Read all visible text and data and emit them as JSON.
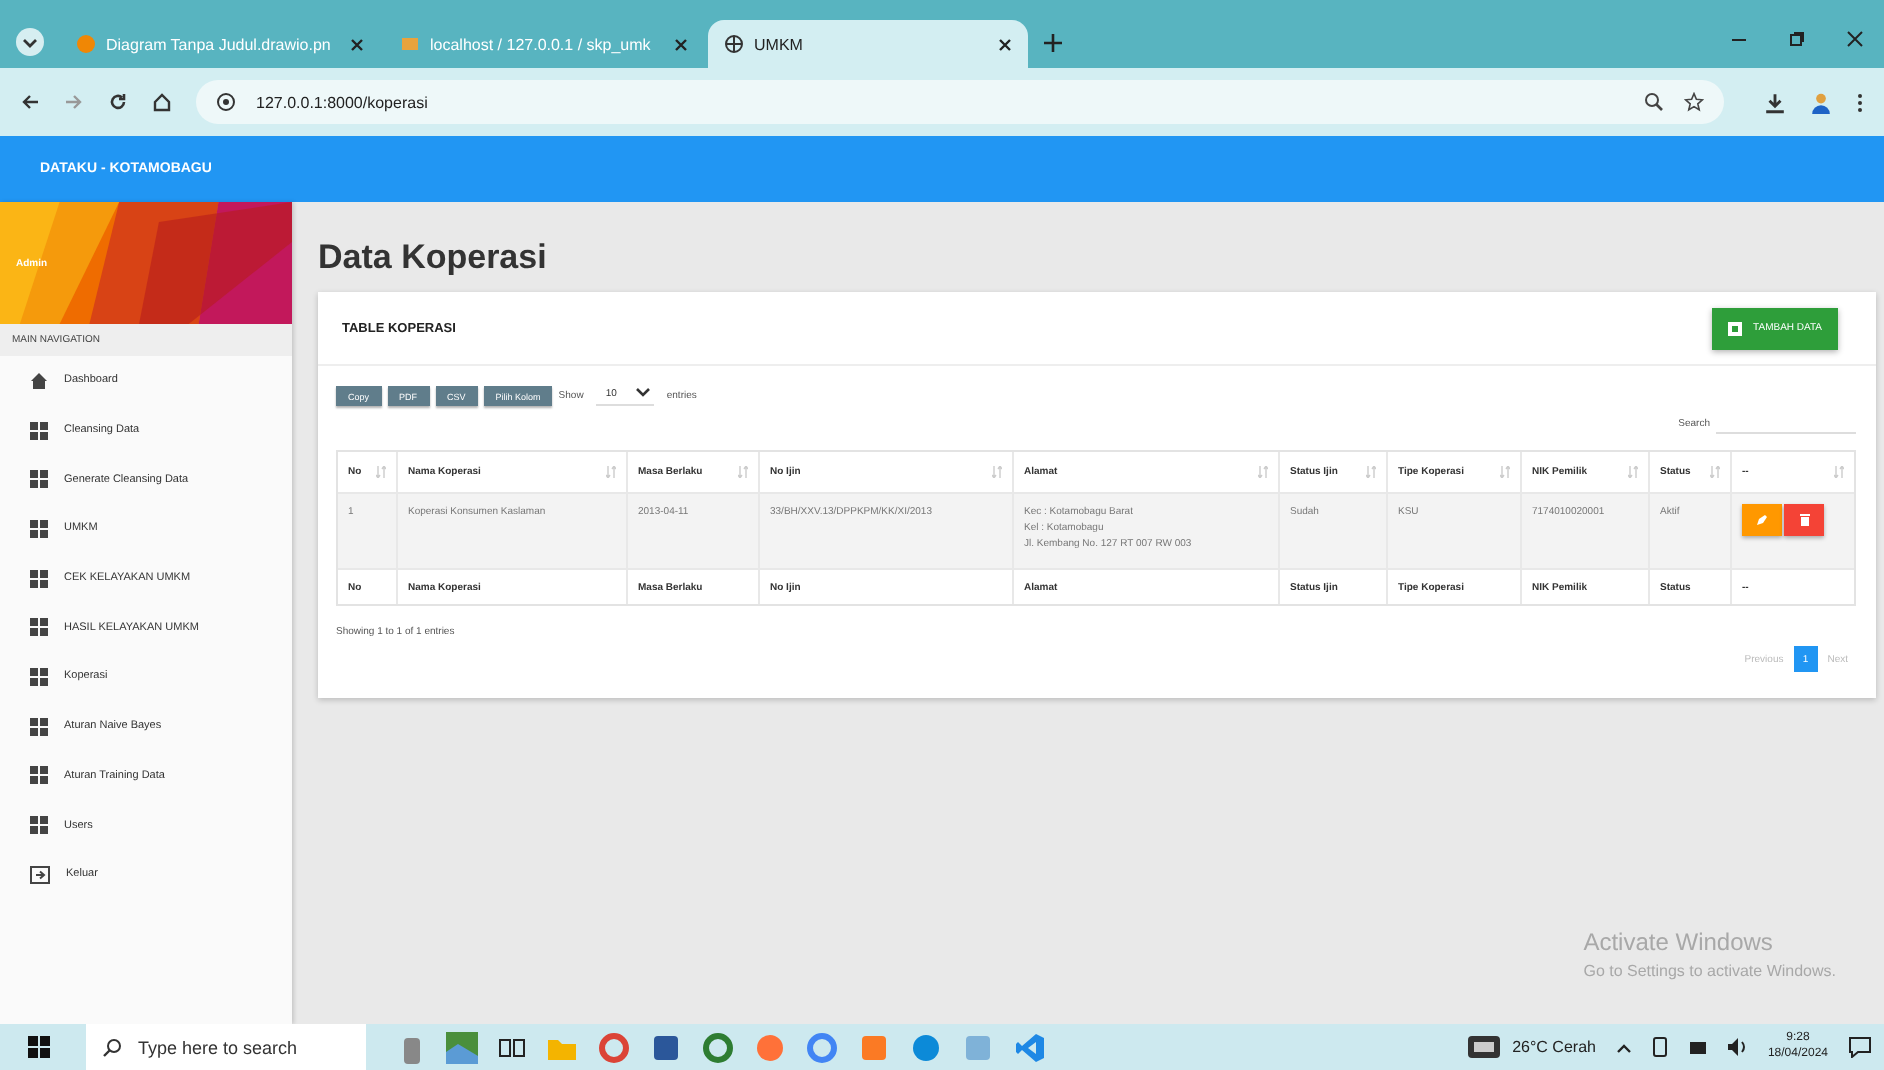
{
  "browser": {
    "tabs": [
      {
        "title": "Diagram Tanpa Judul.drawio.pn",
        "kind": "drawio",
        "selected": false
      },
      {
        "title": "localhost / 127.0.0.1 / skp_umk",
        "kind": "db",
        "selected": false
      },
      {
        "title": "UMKM",
        "kind": "globe",
        "selected": true
      }
    ],
    "url": "127.0.0.1:8000/koperasi"
  },
  "brand": "DATAKU - KOTAMOBAGU",
  "sidebar": {
    "user": "Admin",
    "section": "MAIN NAVIGATION",
    "items": [
      {
        "label": "Dashboard",
        "kind": "home"
      },
      {
        "label": "Cleansing Data",
        "kind": "grid"
      },
      {
        "label": "Generate Cleansing Data",
        "kind": "grid"
      },
      {
        "label": "UMKM",
        "kind": "grid"
      },
      {
        "label": "CEK KELAYAKAN UMKM",
        "kind": "grid"
      },
      {
        "label": "HASIL KELAYAKAN UMKM",
        "kind": "grid"
      },
      {
        "label": "Koperasi",
        "kind": "grid"
      },
      {
        "label": "Aturan Naive Bayes",
        "kind": "grid"
      },
      {
        "label": "Aturan Training Data",
        "kind": "grid"
      },
      {
        "label": "Users",
        "kind": "grid"
      },
      {
        "label": "Keluar",
        "kind": "logout"
      }
    ]
  },
  "page_title": "Data Koperasi",
  "card": {
    "title": "TABLE KOPERASI",
    "add_button": "TAMBAH DATA",
    "export_buttons": [
      "Copy",
      "PDF",
      "CSV",
      "Pilih Kolom"
    ],
    "show_label": "Show",
    "entries_value": "10",
    "entries_label": "entries",
    "search_label": "Search",
    "columns": [
      "No",
      "Nama Koperasi",
      "Masa Berlaku",
      "No Ijin",
      "Alamat",
      "Status Ijin",
      "Tipe Koperasi",
      "NIK Pemilik",
      "Status",
      "--"
    ],
    "rows": [
      {
        "cells": [
          "1",
          "Koperasi Konsumen Kaslaman",
          "2013-04-11",
          "33/BH/XXV.13/DPPKPM/KK/XI/2013",
          [
            "Kec : Kotamobagu Barat",
            "Kel : Kotamobagu",
            "Jl. Kembang No. 127 RT 007 RW 003"
          ],
          "Sudah",
          "KSU",
          "7174010020001",
          "Aktif"
        ]
      }
    ],
    "footer_columns": [
      "No",
      "Nama Koperasi",
      "Masa Berlaku",
      "No Ijin",
      "Alamat",
      "Status Ijin",
      "Tipe Koperasi",
      "NIK Pemilik",
      "Status",
      "--"
    ],
    "info": "Showing 1 to 1 of 1 entries",
    "pagination": {
      "previous": "Previous",
      "pages": [
        {
          "label": "1",
          "selected": true
        }
      ],
      "next": "Next"
    }
  },
  "watermark": {
    "title": "Activate Windows",
    "subtitle": "Go to Settings to activate Windows."
  },
  "taskbar": {
    "search_placeholder": "Type here to search",
    "weather": "26°C  Cerah",
    "time": "9:28",
    "date": "18/04/2024"
  }
}
